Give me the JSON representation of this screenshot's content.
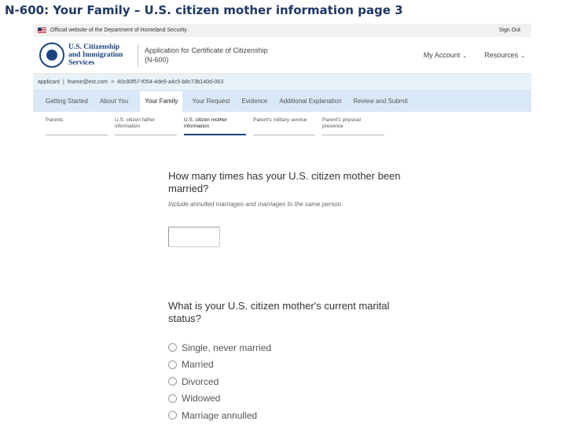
{
  "slide_title": "N-600: Your Family – U.S. citizen mother information page 3",
  "gov_banner": {
    "text": "Official website of the Department of Homeland Security",
    "signout": "Sign Out"
  },
  "header": {
    "agency_line1": "U.S. Citizenship",
    "agency_line2": "and Immigration",
    "agency_line3": "Services",
    "app_title_line1": "Application for Certificate of Citizenship",
    "app_title_line2": "(N-600)",
    "my_account": "My Account",
    "resources": "Resources"
  },
  "account_line": {
    "applicant": "applicant",
    "separator1": "|",
    "email": "fname@ext.com",
    "separator2": ">",
    "receipt": "40c80f57-f054-4de9-a4c5-b8c73b140d-063"
  },
  "main_tabs": [
    "Getting Started",
    "About You",
    "Your Family",
    "Your Request",
    "Evidence",
    "Additional Explanation",
    "Review and Submit"
  ],
  "sub_tabs": [
    {
      "line1": "Parents",
      "line2": ""
    },
    {
      "line1": "U.S. citizen father",
      "line2": "information"
    },
    {
      "line1": "U.S. citizen mother",
      "line2": "information"
    },
    {
      "line1": "Parent's military service",
      "line2": ""
    },
    {
      "line1": "Parent's physical",
      "line2": "presence"
    }
  ],
  "question1": {
    "title": "How many times has your U.S. citizen mother been married?",
    "hint": "Include annulled marriages and marriages to the same person.",
    "value": ""
  },
  "question2": {
    "title": "What is your U.S. citizen mother's current marital status?",
    "options": [
      "Single, never married",
      "Married",
      "Divorced",
      "Widowed",
      "Marriage annulled"
    ]
  }
}
